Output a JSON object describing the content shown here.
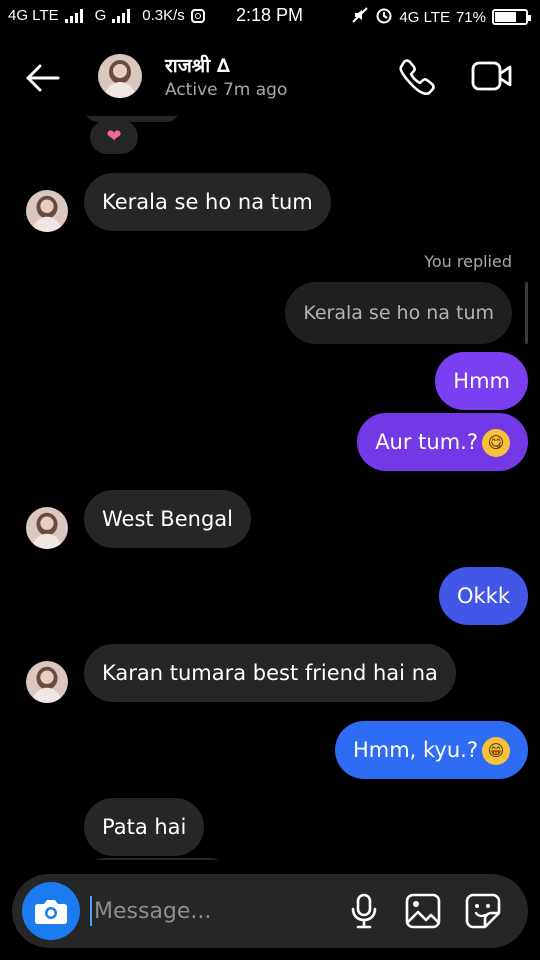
{
  "status_bar": {
    "network1": "4G LTE",
    "network2": "G",
    "speed": "0.3K/s",
    "time": "2:18 PM",
    "network3": "4G LTE",
    "battery": "71%",
    "battery_level": 0.71
  },
  "header": {
    "name": "राजश्री ∆",
    "status": "Active 7m ago"
  },
  "chat": {
    "reaction": "❤",
    "replied_label": "You replied",
    "reply_quote": "Kerala se ho na tum",
    "messages": [
      {
        "direction": "incoming",
        "text": "Kerala se ho na tum"
      },
      {
        "direction": "outgoing",
        "text": "Hmm",
        "color": "#7a3ff0"
      },
      {
        "direction": "outgoing",
        "text": "Aur tum.?",
        "emoji": "😋",
        "color": "#7339e6"
      },
      {
        "direction": "incoming",
        "text": "West Bengal"
      },
      {
        "direction": "outgoing",
        "text": "Okkk",
        "color": "#4257e8"
      },
      {
        "direction": "incoming",
        "text": "Karan tumara best friend hai na"
      },
      {
        "direction": "outgoing",
        "text": "Hmm, kyu.?",
        "emoji": "😁",
        "color": "#2d6cf3"
      },
      {
        "direction": "incoming",
        "text": "Pata hai"
      }
    ]
  },
  "composer": {
    "placeholder": "Message..."
  },
  "colors": {
    "incoming_bubble": "#262626",
    "camera_button": "#1d7bf2"
  },
  "icons": [
    "back-arrow-icon",
    "phone-icon",
    "video-camera-icon",
    "camera-icon",
    "microphone-icon",
    "gallery-icon",
    "sticker-icon",
    "heart-icon"
  ]
}
